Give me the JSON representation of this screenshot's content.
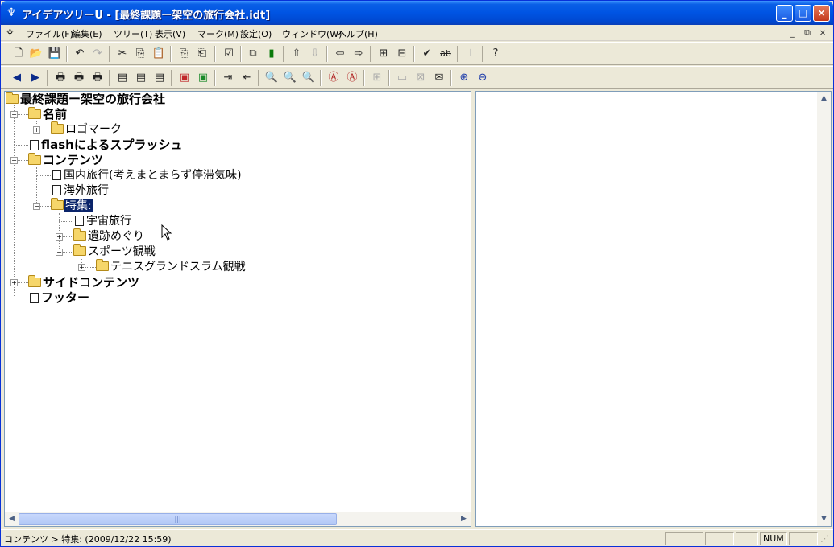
{
  "window": {
    "title": "アイデアツリーU - [最終課題ー架空の旅行会社.idt]",
    "app_icon": "tree-app-icon",
    "controls": {
      "minimize": "_",
      "maximize": "□",
      "close": "×"
    }
  },
  "menubar": {
    "items": [
      "ファイル(F)",
      "編集(E)",
      "ツリー(T)",
      "表示(V)",
      "マーク(M)",
      "設定(O)",
      "ウィンドウ(W)",
      "ヘルプ(H)"
    ],
    "mdi_controls": [
      "_",
      "⧉",
      "×"
    ]
  },
  "toolbar1": {
    "icons": [
      "new-icon",
      "open-icon",
      "save-icon",
      "undo-icon",
      "redo-icon",
      "cut-icon",
      "copy-icon",
      "paste-icon",
      "copy-node-icon",
      "paste-node-icon",
      "check-doc-icon",
      "duplicate-icon",
      "delete-icon",
      "move-up-icon",
      "move-down-icon",
      "move-left-icon",
      "move-right-icon",
      "tree-view-icon",
      "org-chart-icon",
      "checkmark-icon",
      "strikethrough-icon",
      "font-icon",
      "help-icon"
    ]
  },
  "toolbar2": {
    "icons": [
      "prev-icon",
      "next-icon",
      "print-icon",
      "print-preview-icon",
      "print-setup-icon",
      "outline-icon",
      "list-icon",
      "detail-icon",
      "red-mark-icon",
      "green-mark-icon",
      "import-icon",
      "export-icon",
      "search-icon",
      "search-prev-icon",
      "search-next-icon",
      "mark-a-icon",
      "mark-b-icon",
      "tree-icon",
      "link-icon",
      "image-icon",
      "mail-icon",
      "zoom-in-icon",
      "zoom-out-icon"
    ]
  },
  "tree": {
    "root": "最終課題ー架空の旅行会社",
    "nodes": [
      {
        "label": "名前",
        "type": "folder"
      },
      {
        "label": "ロゴマーク",
        "type": "folder"
      },
      {
        "label": "flashによるスプラッシュ",
        "type": "page"
      },
      {
        "label": "コンテンツ",
        "type": "folder"
      },
      {
        "label": "国内旅行(考えまとまらず停滞気味)",
        "type": "page"
      },
      {
        "label": "海外旅行",
        "type": "page"
      },
      {
        "label": "特集:",
        "type": "folder",
        "selected": true
      },
      {
        "label": "宇宙旅行",
        "type": "page"
      },
      {
        "label": "遺跡めぐり",
        "type": "folder"
      },
      {
        "label": "スポーツ観戦",
        "type": "folder"
      },
      {
        "label": "テニスグランドスラム観戦",
        "type": "folder"
      },
      {
        "label": "サイドコンテンツ",
        "type": "folder"
      },
      {
        "label": "フッター",
        "type": "page"
      }
    ]
  },
  "statusbar": {
    "path": "コンテンツ > 特集: (2009/12/22 15:59)",
    "num": "NUM"
  }
}
